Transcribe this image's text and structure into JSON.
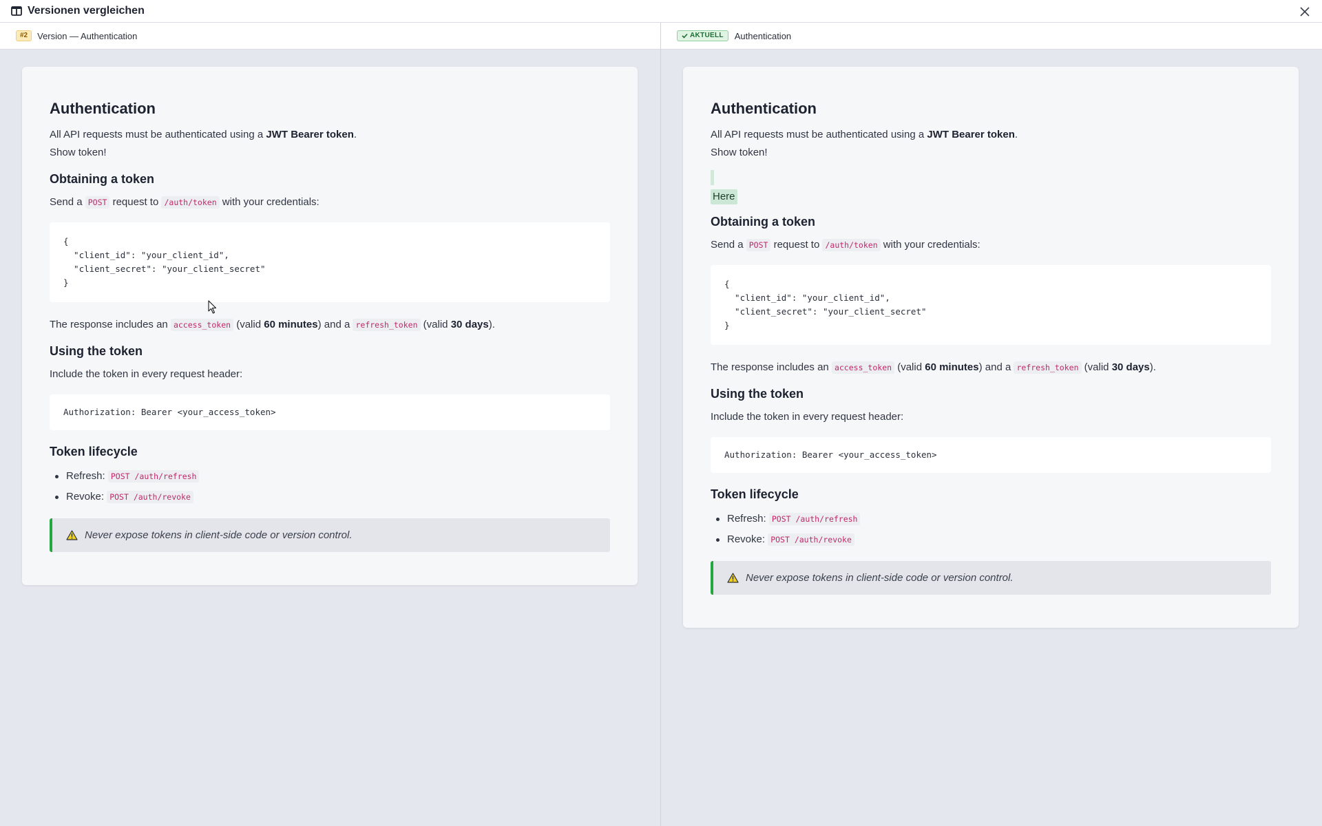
{
  "window": {
    "title": "Versionen vergleichen"
  },
  "left": {
    "badge": "#2",
    "header_title": "Version — Authentication"
  },
  "right": {
    "badge": "AKTUELL",
    "header_title": "Authentication",
    "added_text": "Here"
  },
  "doc": {
    "h1": "Authentication",
    "intro_prefix": "All API requests must be authenticated using a ",
    "intro_bold": "JWT Bearer token",
    "intro_suffix": ".",
    "show_token": "Show token!",
    "h2_obtaining": "Obtaining a token",
    "send_prefix": "Send a ",
    "send_method": "POST",
    "send_mid": " request to ",
    "send_path": "/auth/token",
    "send_suffix": " with your credentials:",
    "code_credentials": "{\n  \"client_id\": \"your_client_id\",\n  \"client_secret\": \"your_client_secret\"\n}",
    "resp_prefix": "The response includes an ",
    "resp_access": "access_token",
    "resp_valid1": " (valid ",
    "resp_60": "60 minutes",
    "resp_and": ") and a ",
    "resp_refresh": "refresh_token",
    "resp_valid2": " (valid ",
    "resp_30": "30 days",
    "resp_end": ").",
    "h2_using": "Using the token",
    "include": "Include the token in every request header:",
    "code_header": "Authorization: Bearer <your_access_token>",
    "h2_lifecycle": "Token lifecycle",
    "refresh_label": "Refresh: ",
    "refresh_code": "POST /auth/refresh",
    "revoke_label": "Revoke: ",
    "revoke_code": "POST /auth/revoke",
    "warning": "Never expose tokens in client-side code or version control."
  },
  "colors": {
    "accent_green": "#23a840",
    "code_pink": "#c0286a",
    "badge_rev_bg": "#fcebb8",
    "badge_current_bg": "#dff4e3"
  },
  "icons": {
    "title": "columns-icon",
    "close": "close-icon",
    "check": "check-icon",
    "warning": "warning-icon",
    "cursor": "mouse-pointer-icon"
  }
}
